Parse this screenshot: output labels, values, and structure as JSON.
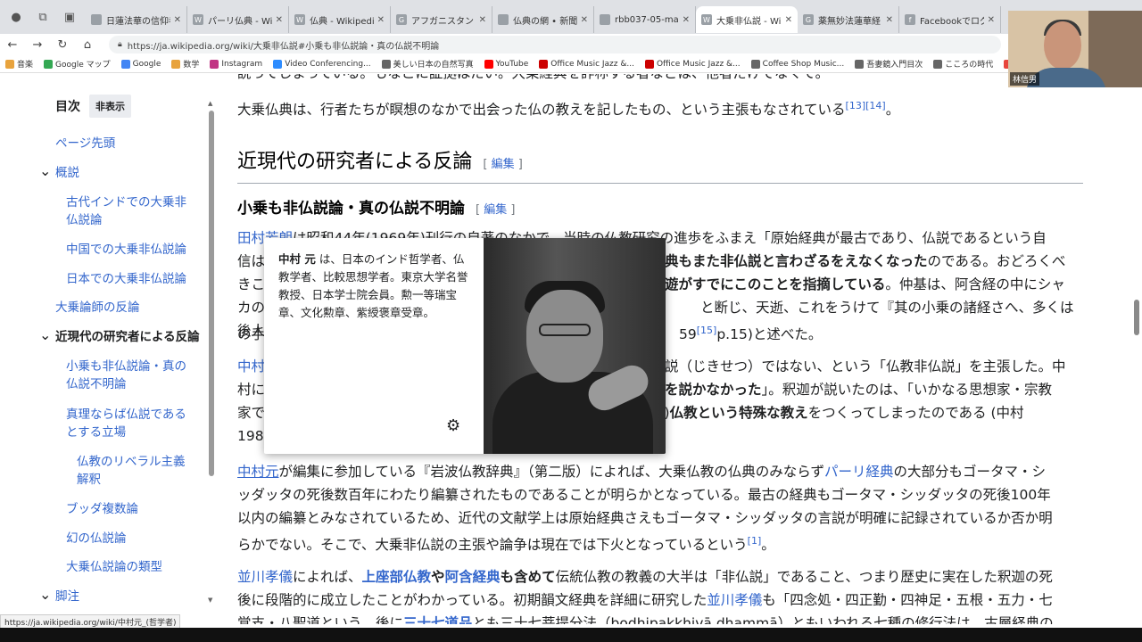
{
  "tabs": [
    {
      "label": "日蓮法華の信仰者は",
      "icon": "doc",
      "active": false
    },
    {
      "label": "パーリ仏典 - Wikipedi",
      "icon": "W",
      "active": false
    },
    {
      "label": "仏典 - Wikipedia",
      "icon": "W",
      "active": false
    },
    {
      "label": "アフガニスタン バーミヤン",
      "icon": "G",
      "active": false
    },
    {
      "label": "仏典の網 • 新聞記事",
      "icon": "doc",
      "active": false
    },
    {
      "label": "rbb037-05-matsuda",
      "icon": "doc",
      "active": false
    },
    {
      "label": "大乗非仏説 - Wikipe",
      "icon": "W",
      "active": true
    },
    {
      "label": "薬無妙法蓮華経 - Go",
      "icon": "G",
      "active": false
    },
    {
      "label": "Facebookでログイン -",
      "icon": "f",
      "active": false
    }
  ],
  "url": "https://ja.wikipedia.org/wiki/大乗非仏説#小乗も非仏説論・真の仏説不明論",
  "bookmarks": [
    "音楽",
    "Google マップ",
    "Google",
    "数学",
    "Instagram",
    "Video Conferencing...",
    "美しい日本の自然写真",
    "YouTube",
    "Office Music Jazz &...",
    "Office Music Jazz &...",
    "Coffee Shop Music...",
    "吾妻鏡入門目次",
    "こころの時代",
    "(4)【仕事がはかどるカ..."
  ],
  "video_name": "林信男",
  "toc": {
    "title": "目次",
    "hide_label": "非表示",
    "items": [
      "ページ先頭",
      "概説",
      "古代インドでの大乗非",
      "仏説論",
      "中国での大乗非仏説論",
      "日本での大乗非仏説論",
      "大乗論師の反論",
      "近現代の研究者による反論",
      "小乗も非仏説論・真の",
      "仏説不明論",
      "真理ならば仏説である",
      "とする立場",
      "仏教のリベラル主義",
      "解釈",
      "ブッダ複数論",
      "幻の仏説論",
      "大乗仏説論の類型",
      "脚注"
    ]
  },
  "article": {
    "top_cut": "説ってしまっている。もなこに証拠はたい。大乗経典を詐称する者などは、他者だけでなくて。",
    "p_intro": "大乗仏典は、行者たちが瞑想のなかで出会った仏の教えを記したもの、という主張もなされている",
    "ref_13": "[13]",
    "ref_14": "[14]",
    "period": "。",
    "h2": "近現代の研究者による反論",
    "edit_label": "編集",
    "h3": "小乗も非仏説論・真の仏説不明論",
    "p1_l1a": "田村芳朗",
    "p1_l1b": "は昭和44年(1969年)刊行の自著のなかで、当時の仏教研究の進歩をふまえ「原始経典が最古であり、仏説であるという自",
    "p1_l2a": "信は",
    "p1_l2b": "典もまた非仏説と言わざるをえなくなった",
    "p1_l2c": "のである。おどろくべ",
    "p1_l3a": "きこ",
    "p1_l3b": "遊がすでにこのことを指摘している",
    "p1_l3c": "。仲基は、阿含経の中にシャ",
    "p1_l4a": "カの",
    "p1_l4b": "と断じ、天逝、これをうけて『其の小乗の諸経さへ、多くは後人",
    "p1_l5a": "の手",
    "p1_l5b": "59",
    "ref_15": "[15]",
    "p1_l5c": "p.15)と述べた。",
    "p2_l1a": "中村",
    "p2_l1b": "説（じきせつ）ではない、という「仏教非仏説」を主張した。中",
    "p2_l2a": "村に",
    "p2_l2b": "を説かなかった",
    "p2_l2c": "」。釈迦が説いたのは、「いかなる思想家・宗教",
    "p2_l3a": "家で",
    "p2_l3b": "路)",
    "p2_l3c": "仏教という特殊な教え",
    "p2_l3d": "をつくってしまったのである (中村",
    "p2_l4a": "198",
    "p3_l1a": "中村元",
    "p3_l1b": "が編集に参加している『岩波仏教辞典』（第二版）によれば、大乗仏教の仏典のみならず",
    "p3_l1c": "パーリ経典",
    "p3_l1d": "の大部分もゴータマ・シ",
    "p3_l2": "ッダッタの死後数百年にわたり編纂されたものであることが明らかとなっている。最古の経典もゴータマ・シッダッタの死後100年",
    "p3_l3": "以内の編纂とみなされているため、近代の文献学上は原始経典さえもゴータマ・シッダッタの言説が明確に記録されているか否か明",
    "p3_l4": "らかでない。そこで、大乗非仏説の主張や論争は現在では下火となっているという",
    "ref_1": "[1]",
    "p4_l1a": "並川孝儀",
    "p4_l1b": "によれば、",
    "p4_l1c": "上座部仏教",
    "p4_l1d": "や",
    "p4_l1e": "阿含経典",
    "p4_l1f": "も含めて",
    "p4_l1g": "伝統仏教の教義の大半は「非仏説」であること、つまり歴史に実在した釈迦の死",
    "p4_l2a": "後に段階的に成立したことがわかっている。初期韻文経典を詳細に研究した",
    "p4_l2b": "並川孝儀",
    "p4_l2c": "も「四念処・四正勤・四神足・五根・五力・七",
    "p4_l3a": "覚支・八聖道という、後に",
    "p4_l3b": "三十七道品",
    "p4_l3c": "とも三十七菩提分法（bodhipakkhivā dhammā）ともいわれる七種の修行法は、古層経典の"
  },
  "popup": {
    "name": "中村 元",
    "text": " は、日本のインド哲学者、仏教学者、比較思想学者。東京大学名誉教授、日本学士院会員。勲一等瑞宝章、文化勲章、紫綬褒章受章。"
  },
  "status_url": "https://ja.wikipedia.org/wiki/中村元_(哲学者)"
}
